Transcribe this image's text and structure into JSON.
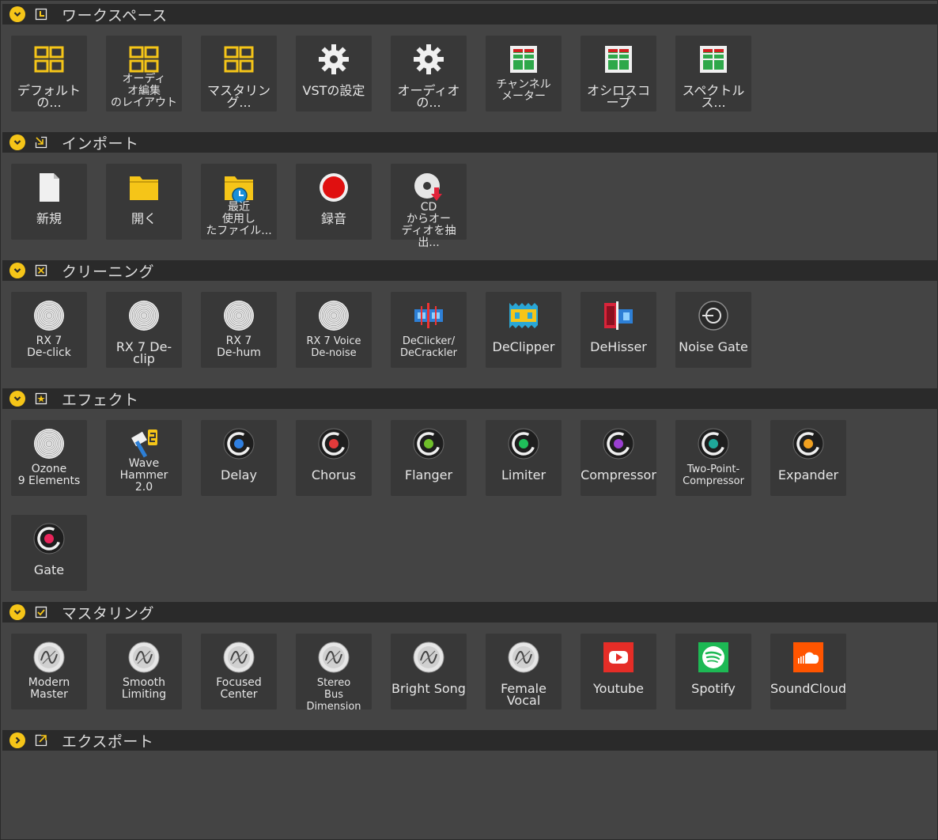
{
  "colors": {
    "accent": "#f5c518",
    "background": "#444444",
    "header": "#2a2a2a",
    "tile": "#383838",
    "record_red": "#e01010",
    "youtube_red": "#e52d27",
    "spotify_green": "#1db954",
    "soundcloud_orange": "#ff5500"
  },
  "sections": [
    {
      "title": "ワークスペース",
      "icon": "workspace-icon",
      "expanded": true,
      "items": [
        {
          "label": "デフォルトの...",
          "icon": "layout-grid-icon"
        },
        {
          "label": "オーディ\nオ編集\nのレイアウト",
          "icon": "layout-grid-icon"
        },
        {
          "label": "マスタリング...",
          "icon": "layout-grid-icon"
        },
        {
          "label": "VSTの設定",
          "icon": "gear-icon"
        },
        {
          "label": "オーディオの...",
          "icon": "gear-icon"
        },
        {
          "label": "チャンネル\nメーター",
          "icon": "meter-panel-icon"
        },
        {
          "label": "オシロスコープ",
          "icon": "meter-panel-icon"
        },
        {
          "label": "スペクトルス...",
          "icon": "meter-panel-icon"
        }
      ]
    },
    {
      "title": "インポート",
      "icon": "import-icon",
      "expanded": true,
      "items": [
        {
          "label": "新規",
          "icon": "new-file-icon"
        },
        {
          "label": "開く",
          "icon": "folder-icon"
        },
        {
          "label": "最近\n使用し\nたファイル...",
          "icon": "recent-folder-icon"
        },
        {
          "label": "録音",
          "icon": "record-icon"
        },
        {
          "label": "CD\nからオー\nディオを抽出...",
          "icon": "cd-extract-icon"
        }
      ]
    },
    {
      "title": "クリーニング",
      "icon": "cleaning-icon",
      "expanded": true,
      "items": [
        {
          "label": "RX 7\nDe-click",
          "icon": "rx-disc-icon"
        },
        {
          "label": "RX 7 De-clip",
          "icon": "rx-disc-icon"
        },
        {
          "label": "RX 7\nDe-hum",
          "icon": "rx-disc-icon"
        },
        {
          "label": "RX 7 Voice\nDe-noise",
          "icon": "rx-disc-icon"
        },
        {
          "label": "DeClicker/\nDeCrackler",
          "icon": "declicker-icon"
        },
        {
          "label": "DeClipper",
          "icon": "declipper-icon"
        },
        {
          "label": "DeHisser",
          "icon": "dehisser-icon"
        },
        {
          "label": "Noise Gate",
          "icon": "noise-gate-icon"
        }
      ]
    },
    {
      "title": "エフェクト",
      "icon": "effects-icon",
      "expanded": true,
      "items": [
        {
          "label": "Ozone\n9 Elements",
          "icon": "ozone-disc-icon"
        },
        {
          "label": "Wave\nHammer\n2.0",
          "icon": "wave-hammer-icon"
        },
        {
          "label": "Delay",
          "icon": "effect-knob-icon",
          "dot": "#2f7fe0"
        },
        {
          "label": "Chorus",
          "icon": "effect-knob-icon",
          "dot": "#e23a3a"
        },
        {
          "label": "Flanger",
          "icon": "effect-knob-icon",
          "dot": "#6fbf2a"
        },
        {
          "label": "Limiter",
          "icon": "effect-knob-icon",
          "dot": "#1fbf5a"
        },
        {
          "label": "Compressor",
          "icon": "effect-knob-icon",
          "dot": "#9a3fd0"
        },
        {
          "label": "Two-Point-\nCompressor",
          "icon": "effect-knob-icon",
          "dot": "#1fa89a"
        },
        {
          "label": "Expander",
          "icon": "effect-knob-icon",
          "dot": "#f0a020"
        },
        {
          "label": "Gate",
          "icon": "effect-knob-icon",
          "dot": "#e8245a"
        }
      ]
    },
    {
      "title": "マスタリング",
      "icon": "mastering-icon",
      "expanded": true,
      "items": [
        {
          "label": "Modern\nMaster",
          "icon": "mastering-preset-icon"
        },
        {
          "label": "Smooth\nLimiting",
          "icon": "mastering-preset-icon"
        },
        {
          "label": "Focused\nCenter",
          "icon": "mastering-preset-icon"
        },
        {
          "label": "Stereo\nBus Dimension",
          "icon": "mastering-preset-icon"
        },
        {
          "label": "Bright Song",
          "icon": "mastering-preset-icon"
        },
        {
          "label": "Female Vocal",
          "icon": "mastering-preset-icon"
        },
        {
          "label": "Youtube",
          "icon": "youtube-icon"
        },
        {
          "label": "Spotify",
          "icon": "spotify-icon"
        },
        {
          "label": "SoundCloud",
          "icon": "soundcloud-icon"
        }
      ]
    },
    {
      "title": "エクスポート",
      "icon": "export-icon",
      "expanded": false,
      "items": []
    }
  ]
}
